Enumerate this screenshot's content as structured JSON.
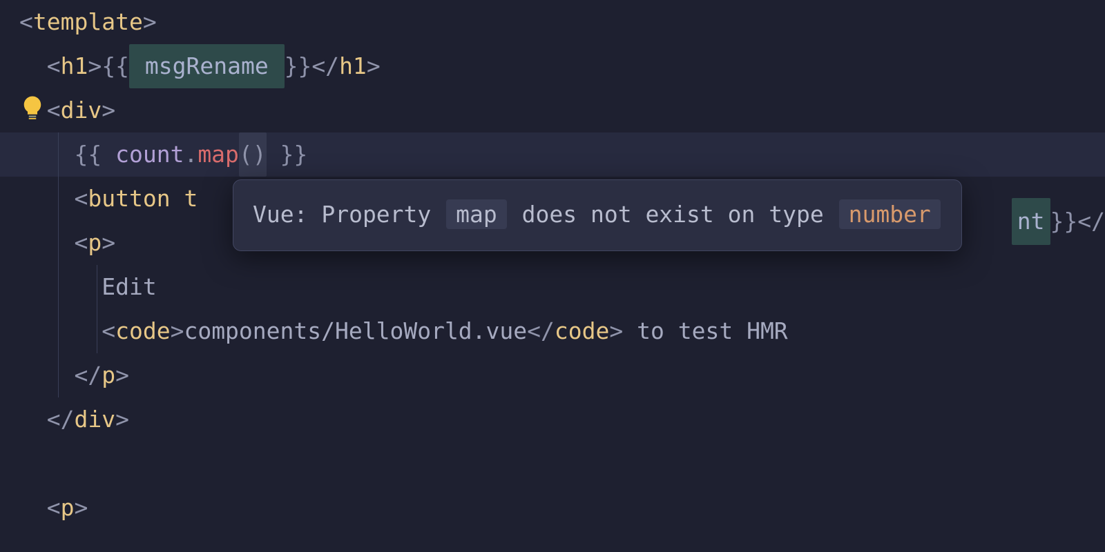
{
  "code": {
    "l1": {
      "open": "<",
      "tag": "template",
      "close": ">"
    },
    "l2": {
      "open": "<",
      "tag": "h1",
      "close": ">",
      "dl": "{{",
      "sp": " ",
      "var": "msgRename",
      "sp2": " ",
      "dr": "}}",
      "copen": "</",
      "ctag": "h1",
      "cclose": ">"
    },
    "l3": {
      "open": "<",
      "tag": "div",
      "close": ">"
    },
    "l4": {
      "dl": "{{ ",
      "var": "count",
      "dot": ".",
      "method": "map",
      "paren": "()",
      "dr": " }}"
    },
    "l5": {
      "open": "<",
      "tag": "button",
      "sp": " ",
      "attr": "t"
    },
    "l5peek": {
      "var": "nt",
      "dr": " }}",
      "copen": "</"
    },
    "l6": {
      "open": "<",
      "tag": "p",
      "close": ">"
    },
    "l7": {
      "text": "Edit"
    },
    "l8": {
      "open": "<",
      "tag": "code",
      "close": ">",
      "text": "components/HelloWorld.vue",
      "copen": "</",
      "ctag": "code",
      "cclose": ">",
      "trail": " to test HMR"
    },
    "l9": {
      "copen": "</",
      "tag": "p",
      "close": ">"
    },
    "l10": {
      "copen": "</",
      "tag": "div",
      "close": ">"
    },
    "l12": {
      "open": "<",
      "tag": "p",
      "close": ">"
    }
  },
  "tooltip": {
    "prefix": "Vue: Property ",
    "chip1": "map",
    "mid": " does not exist on type ",
    "chip2": "number"
  }
}
